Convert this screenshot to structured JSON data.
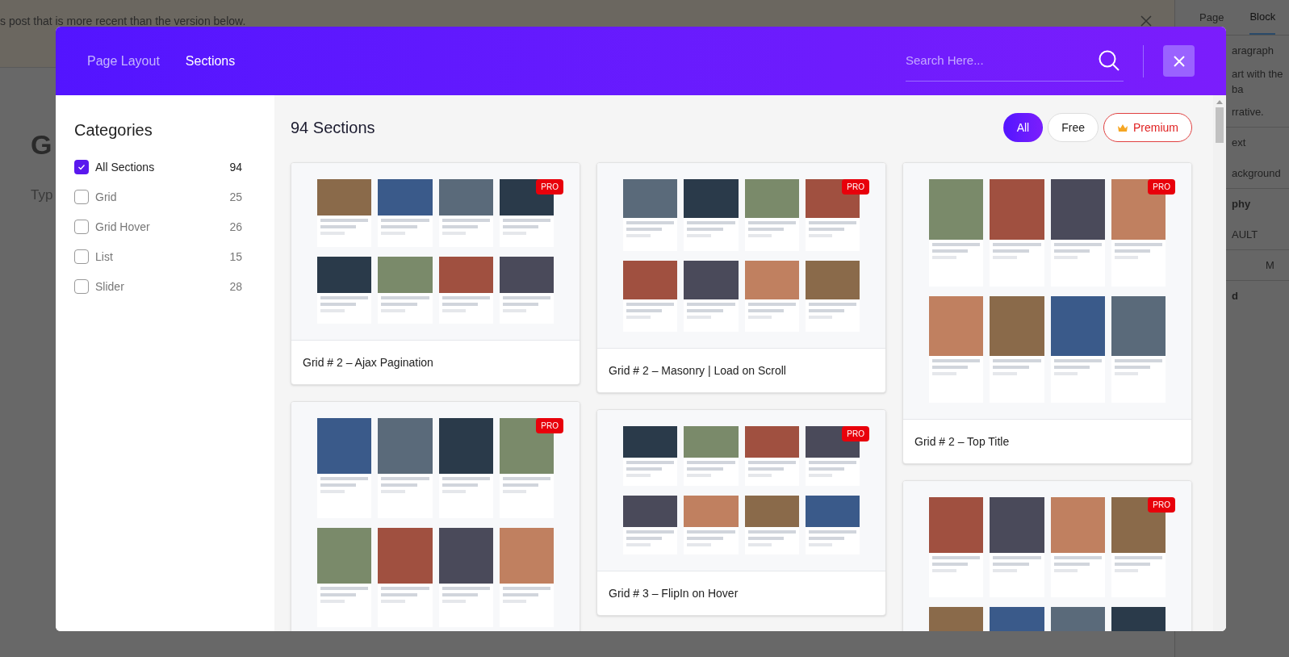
{
  "background": {
    "notice": "s post that is more recent than the version below.",
    "heading": "G",
    "body_hint": "Typ",
    "sidebar_tabs": [
      {
        "label": "Page",
        "selected": false
      },
      {
        "label": "Block",
        "selected": true
      }
    ],
    "sidebar_lines": [
      "aragraph",
      "art with the ba",
      "rrative.",
      "ext",
      "ackground",
      "phy",
      "AULT",
      "M",
      "d"
    ]
  },
  "modal": {
    "tabs": [
      {
        "label": "Page Layout",
        "selected": false
      },
      {
        "label": "Sections",
        "selected": true
      }
    ],
    "search": {
      "placeholder": "Search Here..."
    },
    "categories": {
      "title": "Categories",
      "items": [
        {
          "label": "All Sections",
          "count": "94",
          "checked": true
        },
        {
          "label": "Grid",
          "count": "25",
          "checked": false
        },
        {
          "label": "Grid Hover",
          "count": "26",
          "checked": false
        },
        {
          "label": "List",
          "count": "15",
          "checked": false
        },
        {
          "label": "Slider",
          "count": "28",
          "checked": false
        }
      ]
    },
    "heading": "94 Sections",
    "filters": [
      {
        "label": "All",
        "selected": true,
        "kind": "plain"
      },
      {
        "label": "Free",
        "selected": false,
        "kind": "plain"
      },
      {
        "label": "Premium",
        "selected": false,
        "kind": "premium"
      }
    ],
    "columns": [
      [
        {
          "title": "Grid # 2 – Ajax Pagination",
          "badge": "PRO"
        },
        {
          "badge": "PRO"
        }
      ],
      [
        {
          "title": "Grid # 2 – Masonry | Load on Scroll",
          "badge": "PRO"
        },
        {
          "title": "Grid # 3 – FlipIn on Hover",
          "badge": "PRO"
        }
      ],
      [
        {
          "title": "Grid # 2 – Top Title",
          "badge": "PRO"
        },
        {
          "badge": "PRO"
        }
      ]
    ]
  }
}
